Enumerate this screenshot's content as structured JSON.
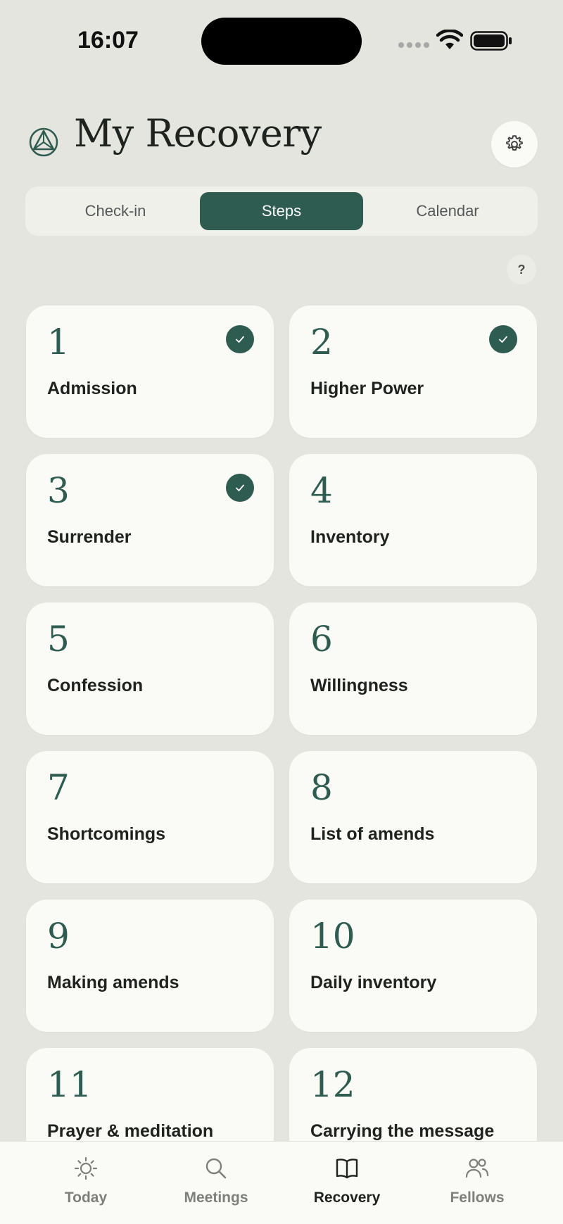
{
  "status_bar": {
    "time": "16:07"
  },
  "header": {
    "title": "My Recovery"
  },
  "colors": {
    "accent": "#2f5c50",
    "background": "#e5e5df",
    "card": "#fafaf6"
  },
  "segments": [
    {
      "label": "Check-in",
      "selected": false
    },
    {
      "label": "Steps",
      "selected": true
    },
    {
      "label": "Calendar",
      "selected": false
    }
  ],
  "help": {
    "label": "?"
  },
  "steps": [
    {
      "number": "1",
      "label": "Admission",
      "completed": true
    },
    {
      "number": "2",
      "label": "Higher Power",
      "completed": true
    },
    {
      "number": "3",
      "label": "Surrender",
      "completed": true
    },
    {
      "number": "4",
      "label": "Inventory",
      "completed": false
    },
    {
      "number": "5",
      "label": "Confession",
      "completed": false
    },
    {
      "number": "6",
      "label": "Willingness",
      "completed": false
    },
    {
      "number": "7",
      "label": "Shortcomings",
      "completed": false
    },
    {
      "number": "8",
      "label": "List of amends",
      "completed": false
    },
    {
      "number": "9",
      "label": "Making amends",
      "completed": false
    },
    {
      "number": "10",
      "label": "Daily inventory",
      "completed": false
    },
    {
      "number": "11",
      "label": "Prayer & meditation",
      "completed": false
    },
    {
      "number": "12",
      "label": "Carrying the message",
      "completed": false
    }
  ],
  "tabs": [
    {
      "label": "Today",
      "icon": "sun-icon",
      "active": false
    },
    {
      "label": "Meetings",
      "icon": "search-icon",
      "active": false
    },
    {
      "label": "Recovery",
      "icon": "book-icon",
      "active": true
    },
    {
      "label": "Fellows",
      "icon": "people-icon",
      "active": false
    }
  ]
}
